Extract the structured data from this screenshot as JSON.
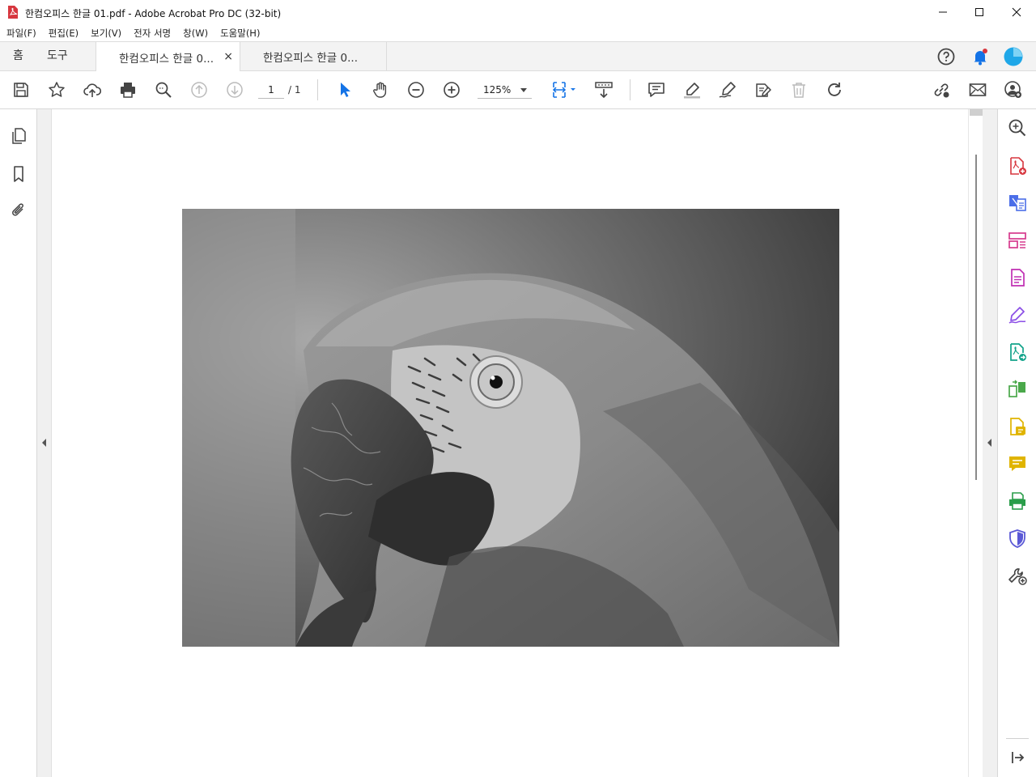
{
  "window": {
    "title": "한컴오피스 한글 01.pdf - Adobe Acrobat Pro DC (32-bit)",
    "app_icon": "acrobat-icon",
    "controls": [
      "minimize-icon",
      "maximize-icon",
      "close-icon"
    ]
  },
  "menu": [
    "파일(F)",
    "편집(E)",
    "보기(V)",
    "전자 서명",
    "창(W)",
    "도움말(H)"
  ],
  "tabs": {
    "home": "홈",
    "tools": "도구",
    "documents": [
      {
        "label": "한컴오피스 한글 0...",
        "active": true,
        "close": "×"
      },
      {
        "label": "한컴오피스 한글 0...",
        "active": false
      }
    ],
    "right_icons": [
      "help-icon",
      "notifications-icon",
      "account-avatar-icon"
    ]
  },
  "toolbar": {
    "icons": [
      "save-icon",
      "bookmark-star-icon",
      "upload-cloud-icon",
      "print-icon",
      "find-icon",
      "previous-page-icon",
      "next-page-icon",
      "select-arrow-icon",
      "hand-icon",
      "zoom-out-icon",
      "zoom-in-icon",
      "fit-page-icon",
      "scrolling-mode-icon",
      "comment-icon",
      "highlight-icon",
      "draw-icon",
      "edit-text-icon",
      "delete-icon",
      "rotate-icon",
      "share-link-icon",
      "email-icon",
      "add-user-icon"
    ],
    "page_current": "1",
    "page_total": "/ 1",
    "zoom": "125%"
  },
  "left_rail": [
    "page-thumbnails-icon",
    "bookmarks-icon",
    "attachments-icon"
  ],
  "right_rail": [
    "search-zoom-icon",
    "create-pdf-icon",
    "export-pdf-icon",
    "organize-pages-icon",
    "edit-pdf-icon",
    "fill-sign-icon",
    "send-for-review-icon",
    "compare-files-icon",
    "scan-ocr-icon",
    "comment-tool-icon",
    "print-production-icon",
    "protect-icon",
    "more-tools-icon",
    "collapse-panel-icon"
  ],
  "colors": {
    "acrobat_red": "#d7373f",
    "notification_blue": "#1473e6",
    "avatar_blue": "#1fa7e8",
    "select_blue": "#1473e6"
  },
  "document": {
    "content": "grayscale photo of a macaw parrot head"
  }
}
